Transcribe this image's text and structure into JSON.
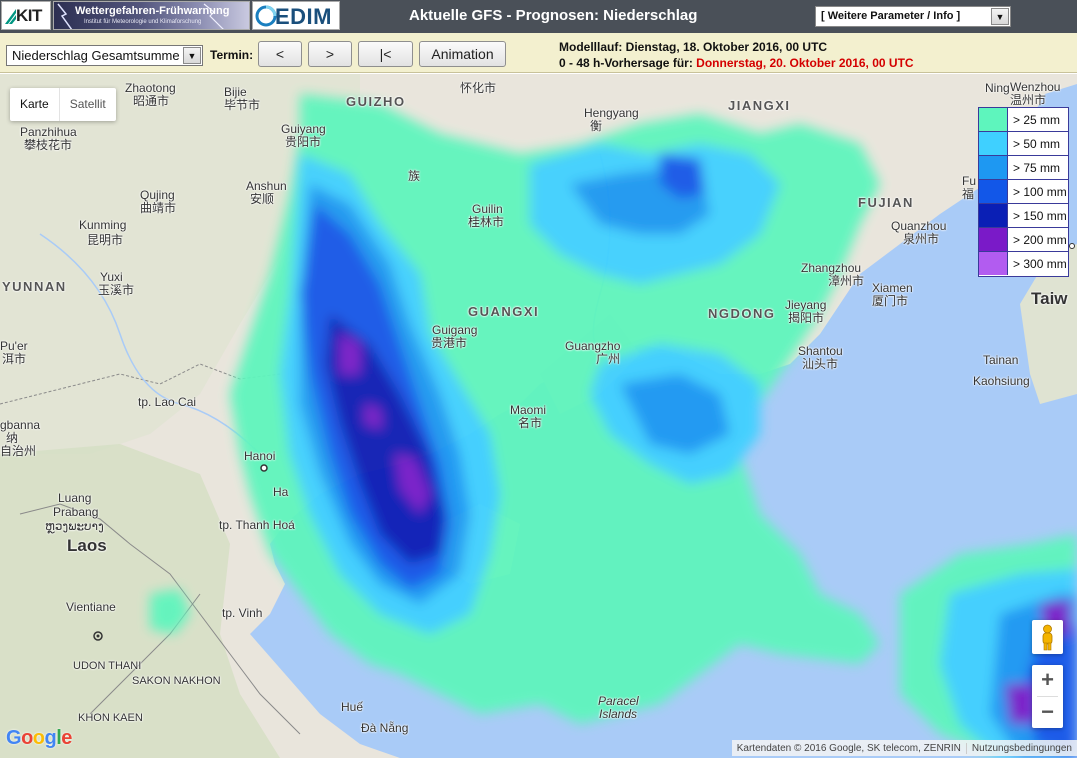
{
  "header": {
    "logos": {
      "kit": "KIT",
      "wf_title": "Wettergefahren-Frühwarnung",
      "wf_subtitle": "Institut für Meteorologie und Klimaforschung",
      "cedim": "EDIM"
    },
    "title": "Aktuelle GFS - Prognosen: Niederschlag",
    "param_select": "[ Weitere Parameter / Info ]"
  },
  "toolbar": {
    "product_select": "Niederschlag Gesamtsumme",
    "termin_label": "Termin:",
    "buttons": {
      "prev": "<",
      "next": ">",
      "first": "|<",
      "animation": "Animation"
    },
    "model_run": "Modelllauf: Dienstag, 18. Oktober 2016, 00 UTC",
    "forecast_prefix": "0 - 48 h-Vorhersage für: ",
    "forecast_date": "Donnerstag, 20. Oktober 2016, 00 UTC"
  },
  "map": {
    "maptype": {
      "karte": "Karte",
      "satellit": "Satellit"
    },
    "legend": [
      {
        "label": "> 25 mm",
        "color": "#5ef5bd"
      },
      {
        "label": "> 50 mm",
        "color": "#3fd0ff"
      },
      {
        "label": "> 75 mm",
        "color": "#1e98f2"
      },
      {
        "label": "> 100 mm",
        "color": "#1257e8"
      },
      {
        "label": "> 150 mm",
        "color": "#0a1fb5"
      },
      {
        "label": "> 200 mm",
        "color": "#7a1ac8"
      },
      {
        "label": "> 300 mm",
        "color": "#b25cf0"
      }
    ],
    "labels": {
      "zhaotong": "Zhaotong",
      "zhaotong_cn": "昭通市",
      "bijie": "Bijie",
      "bijie_cn": "毕节市",
      "huaihua": "怀化市",
      "guizhou": "GUIZHO",
      "hengyang": "Hengyang",
      "hengyang_cn": "衡",
      "jiangxi": "JIANGXI",
      "wenzhou": "Wenzhou",
      "wenzhou_cn": "温州市",
      "panzhihua": "Panzhihua",
      "panzhihua_cn": "攀枝花市",
      "guiyang": "Guiyang",
      "guiyang_cn": "贵阳市",
      "zu": "族",
      "anshun": "Anshun",
      "anshun_cn": "安顺",
      "qujing": "Qujing",
      "qujing_cn": "曲靖市",
      "guilin": "Guilin",
      "guilin_cn": "桂林市",
      "fujian": "FUJIAN",
      "quanzhou": "Quanzhou",
      "quanzhou_cn": "泉州市",
      "kunming": "Kunming",
      "kunming_cn": "昆明市",
      "yuxi": "Yuxi",
      "yuxi_cn": "玉溪市",
      "yunnan": "YUNNAN",
      "zhangzhou": "Zhangzhou",
      "zhangzhou_cn": "漳州市",
      "xiamen": "Xiamen",
      "xiamen_cn": "厦门市",
      "jieyang": "Jieyang",
      "jieyang_cn": "揭阳市",
      "guangxi": "GUANGXI",
      "ngdong": "NGDONG",
      "guigang": "Guigang",
      "guigang_cn": "贵港市",
      "guangzhou": "Guangzho",
      "guangzhou_cn": "广州",
      "shantou": "Shantou",
      "shantou_cn": "汕头市",
      "puer": "Pu'er",
      "puer_cn": "洱市",
      "tainan": "Tainan",
      "kaohsiung": "Kaohsiung",
      "taiwan": "Taiw",
      "lao_cai": "tp. Lao Cai",
      "banna": "gbanna",
      "banna_cn1": "纳",
      "banna_cn2": "自治州",
      "maoming": "Maomi",
      "maoming_cn": "名市",
      "hanoi": "Hanoi",
      "ha": "Ha",
      "luang": "Luang",
      "prabang": "Prabang",
      "lao_script": "ຫຼວງພະບາງ",
      "thanh_hoa": "tp. Thanh Hoá",
      "laos": "Laos",
      "vinh": "tp. Vinh",
      "vientiane": "Vientiane",
      "udon": "UDON THANI",
      "sakon": "SAKON NAKHON",
      "khon": "KHON KAEN",
      "paracel1": "Paracel",
      "paracel2": "Islands",
      "hue": "Huế",
      "danang": "Đà Nẵng",
      "fu": "Fu",
      "fu_cn": "福",
      "ning": "Ning"
    },
    "attribution": "Kartendaten © 2016 Google, SK telecom, ZENRIN",
    "terms": "Nutzungsbedingungen",
    "google": "Google",
    "zoom_in": "+",
    "zoom_out": "−"
  }
}
